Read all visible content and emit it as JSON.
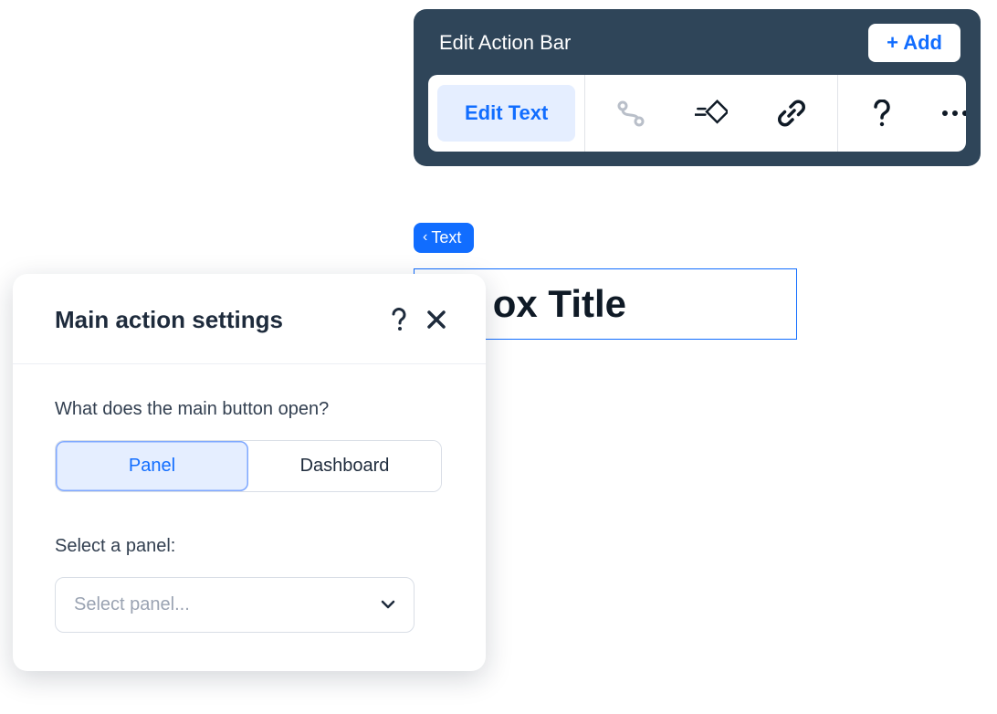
{
  "actionBar": {
    "title": "Edit Action Bar",
    "addLabel": "+ Add",
    "editTextLabel": "Edit Text"
  },
  "chip": {
    "label": "Text"
  },
  "titleBox": {
    "visibleText": "ox Title"
  },
  "settings": {
    "title": "Main action settings",
    "q1": "What does the main button open?",
    "option1": "Panel",
    "option2": "Dashboard",
    "q2": "Select a panel:",
    "selectPlaceholder": "Select panel..."
  }
}
